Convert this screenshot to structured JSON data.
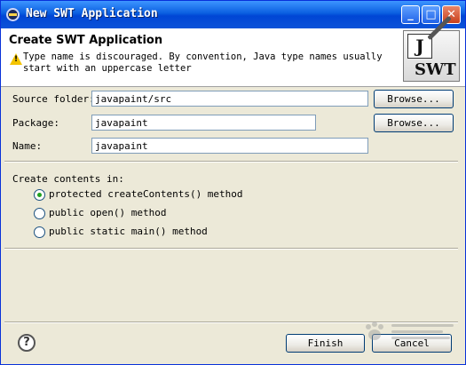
{
  "window": {
    "title": "New SWT Application",
    "controls": {
      "minimize": "_",
      "maximize": "□",
      "close": "✕"
    }
  },
  "banner": {
    "title": "Create SWT Application",
    "warning_icon": "warning-triangle-icon",
    "message": "Type name is discouraged. By convention, Java type names usually start with an uppercase letter",
    "logo": {
      "letter": "J",
      "text": "SWT"
    }
  },
  "form": {
    "source_folder": {
      "label": "Source folder:",
      "value": "javapaint/src",
      "browse_label": "Browse..."
    },
    "package": {
      "label": "Package:",
      "value": "javapaint",
      "browse_label": "Browse..."
    },
    "name": {
      "label": "Name:",
      "value": "javapaint"
    }
  },
  "create_contents": {
    "label": "Create contents in:",
    "options": [
      {
        "label": "protected createContents() method",
        "checked": true
      },
      {
        "label": "public open() method",
        "checked": false
      },
      {
        "label": "public static main() method",
        "checked": false
      }
    ]
  },
  "footer": {
    "help_icon": "help-question-icon",
    "help_text": "?",
    "finish_label": "Finish",
    "cancel_label": "Cancel"
  },
  "colors": {
    "titlebar": "#0a5fe0",
    "dialog_bg": "#ece9d8",
    "radio_checked": "#21a121",
    "warning": "#f4c400"
  }
}
